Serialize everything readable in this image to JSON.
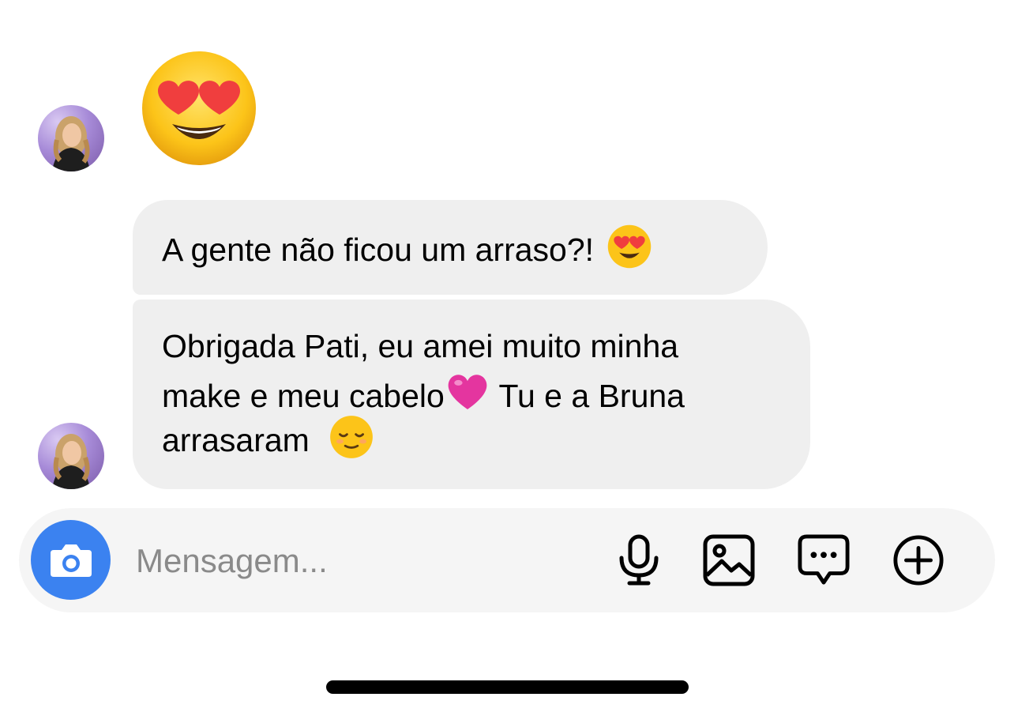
{
  "conversation": {
    "big_emoji": "😍",
    "messages": [
      {
        "lines": [
          "A gente não ficou um arraso?!"
        ],
        "trailing_emoji": "😍"
      },
      {
        "lines": [
          "Obrigada Pati, eu amei muito minha",
          "make e meu cabelo",
          " Tu e a Bruna",
          "arrasaram"
        ],
        "emojis": [
          "💗",
          "😌"
        ]
      }
    ]
  },
  "composer": {
    "placeholder": "Mensagem...",
    "icons": [
      "camera-icon",
      "microphone-icon",
      "gallery-icon",
      "sticker-chat-icon",
      "plus-icon"
    ],
    "accent_color": "#3b82f0"
  }
}
